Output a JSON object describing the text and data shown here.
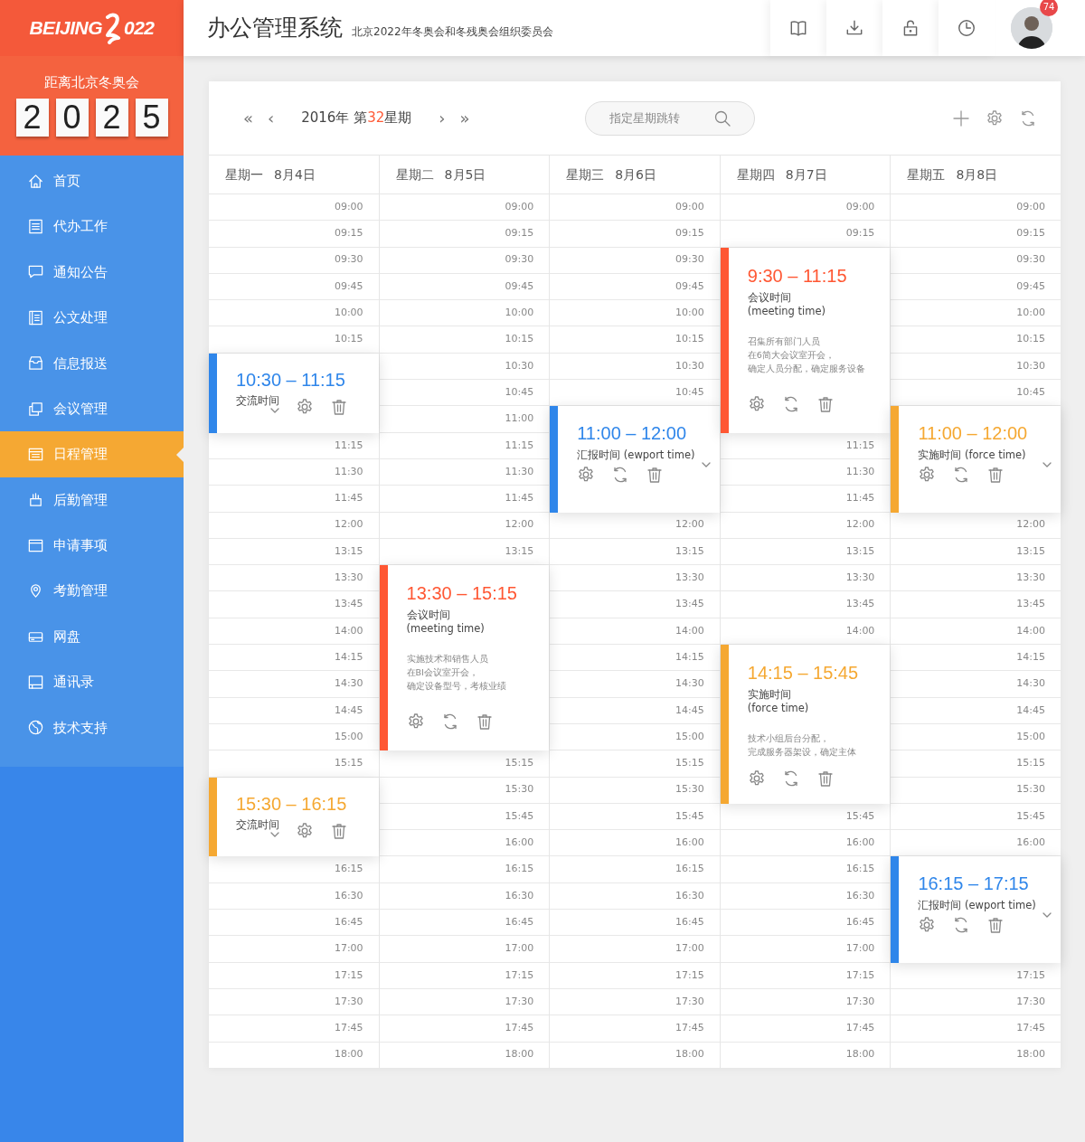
{
  "sidebar": {
    "logo": "BEIJING",
    "logo_year": "022",
    "countdown_label": "距离北京冬奥会",
    "countdown_digits": [
      "2",
      "0",
      "2",
      "5"
    ],
    "items": [
      {
        "label": "首页",
        "selected": false
      },
      {
        "label": "代办工作",
        "selected": false
      },
      {
        "label": "通知公告",
        "selected": false
      },
      {
        "label": "公文处理",
        "selected": false
      },
      {
        "label": "信息报送",
        "selected": false
      },
      {
        "label": "会议管理",
        "selected": false
      },
      {
        "label": "日程管理",
        "selected": true
      },
      {
        "label": "后勤管理",
        "selected": false
      },
      {
        "label": "申请事项",
        "selected": false
      },
      {
        "label": "考勤管理",
        "selected": false
      },
      {
        "label": "网盘",
        "selected": false
      },
      {
        "label": "通讯录",
        "selected": false
      },
      {
        "label": "技术支持",
        "selected": false
      }
    ]
  },
  "header": {
    "title": "办公管理系统",
    "subtitle": "北京2022年冬奥会和冬残奥会组织委员会",
    "badge": "74"
  },
  "toolbar": {
    "first": "«",
    "prev": "‹",
    "week_prefix": "2016年 第",
    "week_number": "32",
    "week_suffix": "星期",
    "next": "›",
    "last": "»",
    "search": {
      "placeholder": "指定星期跳转"
    }
  },
  "days": [
    {
      "name": "星期一",
      "date": "8月4日",
      "rows": [
        {
          "kind": "time",
          "text": "09:00"
        },
        {
          "kind": "time",
          "text": "09:15"
        },
        {
          "kind": "time",
          "text": "09:30"
        },
        {
          "kind": "time",
          "text": "09:45"
        },
        {
          "kind": "time",
          "text": "10:00"
        },
        {
          "kind": "time",
          "text": "10:15"
        },
        {
          "kind": "brief",
          "color": "#2f86ea",
          "time": "10:30 – 11:15",
          "label": "交流时间"
        },
        {
          "kind": "time",
          "text": "11:15"
        },
        {
          "kind": "time",
          "text": "11:30"
        },
        {
          "kind": "time",
          "text": "11:45"
        },
        {
          "kind": "time",
          "text": "12:00"
        },
        {
          "kind": "time",
          "text": "13:15"
        },
        {
          "kind": "time",
          "text": "13:30"
        },
        {
          "kind": "time",
          "text": "13:45"
        },
        {
          "kind": "time",
          "text": "14:00"
        },
        {
          "kind": "time",
          "text": "14:15"
        },
        {
          "kind": "time",
          "text": "14:30"
        },
        {
          "kind": "time",
          "text": "14:45"
        },
        {
          "kind": "time",
          "text": "15:00"
        },
        {
          "kind": "time",
          "text": "15:15"
        },
        {
          "kind": "brief",
          "color": "#f5a832",
          "time": "15:30 – 16:15",
          "label": "交流时间"
        },
        {
          "kind": "time",
          "text": "16:15"
        },
        {
          "kind": "time",
          "text": "16:30"
        },
        {
          "kind": "time",
          "text": "16:45"
        },
        {
          "kind": "time",
          "text": "17:00"
        },
        {
          "kind": "time",
          "text": "17:15"
        },
        {
          "kind": "time",
          "text": "17:30"
        },
        {
          "kind": "time",
          "text": "17:45"
        },
        {
          "kind": "time",
          "text": "18:00"
        }
      ]
    },
    {
      "name": "星期二",
      "date": "8月5日",
      "rows": [
        {
          "kind": "time",
          "text": "09:00"
        },
        {
          "kind": "time",
          "text": "09:15"
        },
        {
          "kind": "time",
          "text": "09:30"
        },
        {
          "kind": "time",
          "text": "09:45"
        },
        {
          "kind": "time",
          "text": "10:00"
        },
        {
          "kind": "time",
          "text": "10:15"
        },
        {
          "kind": "time",
          "text": "10:30"
        },
        {
          "kind": "time",
          "text": "10:45"
        },
        {
          "kind": "time",
          "text": "11:00"
        },
        {
          "kind": "time",
          "text": "11:15"
        },
        {
          "kind": "time",
          "text": "11:30"
        },
        {
          "kind": "time",
          "text": "11:45"
        },
        {
          "kind": "time",
          "text": "12:00"
        },
        {
          "kind": "time",
          "text": "13:15"
        },
        {
          "kind": "detailed",
          "color": "#ff5733",
          "time": "13:30 – 15:15",
          "label": "会议时间",
          "label_en": "(meeting time)",
          "description": [
            "实施技术和销售人员",
            "在BI会议室开会，",
            "确定设备型号，考核业绩"
          ]
        },
        {
          "kind": "time",
          "text": "15:15"
        },
        {
          "kind": "time",
          "text": "15:30"
        },
        {
          "kind": "time",
          "text": "15:45"
        },
        {
          "kind": "time",
          "text": "16:00"
        },
        {
          "kind": "time",
          "text": "16:15"
        },
        {
          "kind": "time",
          "text": "16:30"
        },
        {
          "kind": "time",
          "text": "16:45"
        },
        {
          "kind": "time",
          "text": "17:00"
        },
        {
          "kind": "time",
          "text": "17:15"
        },
        {
          "kind": "time",
          "text": "17:30"
        },
        {
          "kind": "time",
          "text": "17:45"
        },
        {
          "kind": "time",
          "text": "18:00"
        }
      ]
    },
    {
      "name": "星期三",
      "date": "8月6日",
      "rows": [
        {
          "kind": "time",
          "text": "09:00"
        },
        {
          "kind": "time",
          "text": "09:15"
        },
        {
          "kind": "time",
          "text": "09:30"
        },
        {
          "kind": "time",
          "text": "09:45"
        },
        {
          "kind": "time",
          "text": "10:00"
        },
        {
          "kind": "time",
          "text": "10:15"
        },
        {
          "kind": "time",
          "text": "10:30"
        },
        {
          "kind": "time",
          "text": "10:45"
        },
        {
          "kind": "report",
          "color": "#2f86ea",
          "time": "11:00 – 12:00",
          "label": "汇报时间 (ewport time)"
        },
        {
          "kind": "time",
          "text": "12:00"
        },
        {
          "kind": "time",
          "text": "13:15"
        },
        {
          "kind": "time",
          "text": "13:30"
        },
        {
          "kind": "time",
          "text": "13:45"
        },
        {
          "kind": "time",
          "text": "14:00"
        },
        {
          "kind": "time",
          "text": "14:15"
        },
        {
          "kind": "time",
          "text": "14:30"
        },
        {
          "kind": "time",
          "text": "14:45"
        },
        {
          "kind": "time",
          "text": "15:00"
        },
        {
          "kind": "time",
          "text": "15:15"
        },
        {
          "kind": "time",
          "text": "15:30"
        },
        {
          "kind": "time",
          "text": "15:45"
        },
        {
          "kind": "time",
          "text": "16:00"
        },
        {
          "kind": "time",
          "text": "16:15"
        },
        {
          "kind": "time",
          "text": "16:30"
        },
        {
          "kind": "time",
          "text": "16:45"
        },
        {
          "kind": "time",
          "text": "17:00"
        },
        {
          "kind": "time",
          "text": "17:15"
        },
        {
          "kind": "time",
          "text": "17:30"
        },
        {
          "kind": "time",
          "text": "17:45"
        },
        {
          "kind": "time",
          "text": "18:00"
        }
      ]
    },
    {
      "name": "星期四",
      "date": "8月7日",
      "rows": [
        {
          "kind": "time",
          "text": "09:00"
        },
        {
          "kind": "time",
          "text": "09:15"
        },
        {
          "kind": "detailed",
          "color": "#ff5733",
          "time": "9:30 – 11:15",
          "label": "会议时间",
          "label_en": "(meeting time)",
          "description": [
            "召集所有部门人员",
            "在6简大会议室开会，",
            "确定人员分配，确定服务设备"
          ]
        },
        {
          "kind": "time",
          "text": "11:15"
        },
        {
          "kind": "time",
          "text": "11:30"
        },
        {
          "kind": "time",
          "text": "11:45"
        },
        {
          "kind": "time",
          "text": "12:00"
        },
        {
          "kind": "time",
          "text": "13:15"
        },
        {
          "kind": "time",
          "text": "13:30"
        },
        {
          "kind": "time",
          "text": "13:45"
        },
        {
          "kind": "time",
          "text": "14:00"
        },
        {
          "kind": "detailed",
          "color": "#f5a832",
          "time": "14:15 – 15:45",
          "label": "实施时间",
          "label_en": "(force time)",
          "description": [
            "技术小组后台分配，",
            "完成服务器架设，确定主体"
          ]
        },
        {
          "kind": "time",
          "text": "15:45"
        },
        {
          "kind": "time",
          "text": "16:00"
        },
        {
          "kind": "time",
          "text": "16:15"
        },
        {
          "kind": "time",
          "text": "16:30"
        },
        {
          "kind": "time",
          "text": "16:45"
        },
        {
          "kind": "time",
          "text": "17:00"
        },
        {
          "kind": "time",
          "text": "17:15"
        },
        {
          "kind": "time",
          "text": "17:30"
        },
        {
          "kind": "time",
          "text": "17:45"
        },
        {
          "kind": "time",
          "text": "18:00"
        }
      ]
    },
    {
      "name": "星期五",
      "date": "8月8日",
      "rows": [
        {
          "kind": "time",
          "text": "09:00"
        },
        {
          "kind": "time",
          "text": "09:15"
        },
        {
          "kind": "time",
          "text": "09:30"
        },
        {
          "kind": "time",
          "text": "09:45"
        },
        {
          "kind": "time",
          "text": "10:00"
        },
        {
          "kind": "time",
          "text": "10:15"
        },
        {
          "kind": "time",
          "text": "10:30"
        },
        {
          "kind": "time",
          "text": "10:45"
        },
        {
          "kind": "report",
          "color": "#f5a832",
          "time": "11:00 – 12:00",
          "label": "实施时间 (force time)"
        },
        {
          "kind": "time",
          "text": "12:00"
        },
        {
          "kind": "time",
          "text": "13:15"
        },
        {
          "kind": "time",
          "text": "13:30"
        },
        {
          "kind": "time",
          "text": "13:45"
        },
        {
          "kind": "time",
          "text": "14:00"
        },
        {
          "kind": "time",
          "text": "14:15"
        },
        {
          "kind": "time",
          "text": "14:30"
        },
        {
          "kind": "time",
          "text": "14:45"
        },
        {
          "kind": "time",
          "text": "15:00"
        },
        {
          "kind": "time",
          "text": "15:15"
        },
        {
          "kind": "time",
          "text": "15:30"
        },
        {
          "kind": "time",
          "text": "15:45"
        },
        {
          "kind": "time",
          "text": "16:00"
        },
        {
          "kind": "report",
          "color": "#2f86ea",
          "time": "16:15 – 17:15",
          "label": "汇报时间 (ewport time)"
        },
        {
          "kind": "time",
          "text": "17:15"
        },
        {
          "kind": "time",
          "text": "17:30"
        },
        {
          "kind": "time",
          "text": "17:45"
        },
        {
          "kind": "time",
          "text": "18:00"
        }
      ]
    }
  ]
}
